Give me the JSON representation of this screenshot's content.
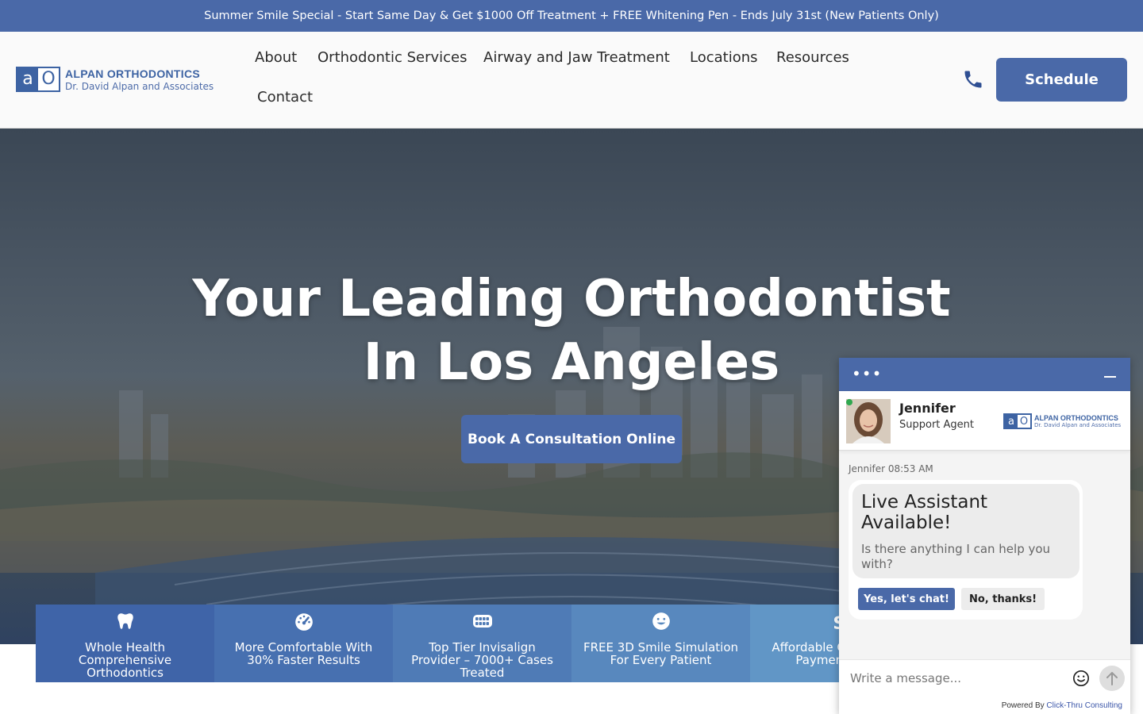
{
  "promo": {
    "text": "Summer Smile Special - Start Same Day & Get $1000 Off Treatment + FREE Whitening Pen - Ends July 31st (New Patients Only)"
  },
  "brand": {
    "mark_a": "a",
    "mark_o": "O",
    "name": "ALPAN ORTHODONTICS",
    "tagline": "Dr. David Alpan and Associates",
    "color": "#4a69a8"
  },
  "nav": {
    "items": [
      {
        "label": "About"
      },
      {
        "label": "Orthodontic Services"
      },
      {
        "label": "Airway and Jaw Treatment"
      },
      {
        "label": "Locations"
      },
      {
        "label": "Resources"
      },
      {
        "label": "Contact"
      }
    ],
    "phone_icon": "phone-icon",
    "schedule_label": "Schedule"
  },
  "hero": {
    "title_line1": "Your Leading Orthodontist",
    "title_line2": "In Los Angeles",
    "cta_label": "Book A Consultation Online"
  },
  "features": [
    {
      "icon": "tooth-icon",
      "text": "Whole Health Comprehensive Orthodontics",
      "color": "#3f64a8"
    },
    {
      "icon": "gauge-icon",
      "text": "More Comfortable With 30% Faster Results",
      "color": "#4770b0"
    },
    {
      "icon": "aligner-icon",
      "text": "Top Tier Invisalign Provider – 7000+ Cases Treated",
      "color": "#4f7bb6"
    },
    {
      "icon": "smile-icon",
      "text": "FREE 3D Smile Simulation For Every Patient",
      "color": "#5888be"
    },
    {
      "icon": "dollar-icon",
      "text": "Affordable Customized Payment Plans",
      "color": "#6196c6"
    }
  ],
  "chat": {
    "menu_dots": "•••",
    "agent_name": "Jennifer",
    "agent_role": "Support Agent",
    "meta": "Jennifer 08:53 AM",
    "bubble_title": "Live Assistant Available!",
    "bubble_body": "Is there anything I can help you with?",
    "yes_label": "Yes, let's chat!",
    "no_label": "No, thanks!",
    "input_placeholder": "Write a message...",
    "powered_prefix": "Powered By ",
    "powered_link": "Click-Thru Consulting"
  }
}
